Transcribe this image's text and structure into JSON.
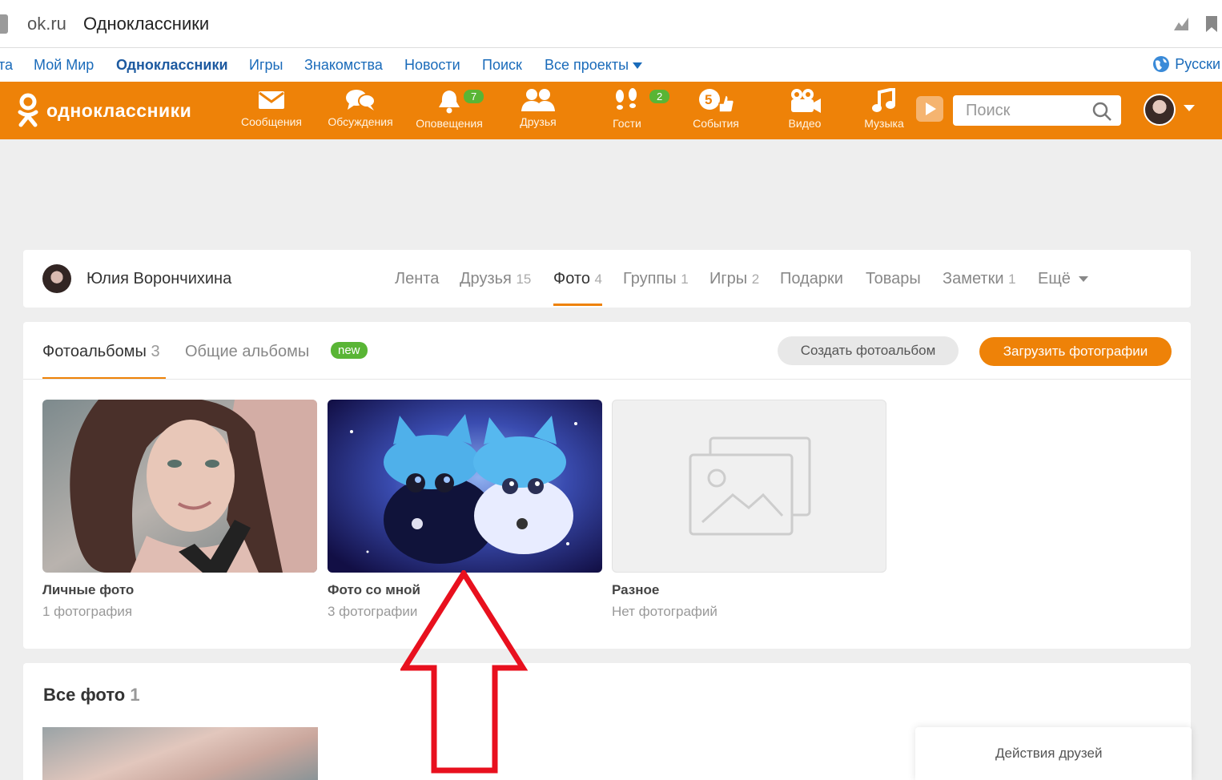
{
  "browser": {
    "domain": "ok.ru",
    "page_title": "Одноклассники"
  },
  "projects": {
    "items": [
      "та",
      "Мой Мир",
      "Одноклассники",
      "Игры",
      "Знакомства",
      "Новости",
      "Поиск",
      "Все проекты"
    ],
    "language": "Русски"
  },
  "header": {
    "logo_text": "одноклассники",
    "nav": [
      {
        "label": "Сообщения",
        "icon": "envelope-icon"
      },
      {
        "label": "Обсуждения",
        "icon": "chat-bubbles-icon"
      },
      {
        "label": "Оповещения",
        "icon": "bell-icon",
        "badge": "7"
      },
      {
        "label": "Друзья",
        "icon": "friends-icon"
      },
      {
        "label": "Гости",
        "icon": "footprints-icon",
        "badge": "2"
      },
      {
        "label": "События",
        "icon": "five-thumbs-up-icon"
      },
      {
        "label": "Видео",
        "icon": "video-camera-icon"
      },
      {
        "label": "Музыка",
        "icon": "music-note-icon"
      }
    ],
    "search_placeholder": "Поиск"
  },
  "profile": {
    "name": "Юлия Ворончихина",
    "tabs": [
      {
        "label": "Лента",
        "count": ""
      },
      {
        "label": "Друзья",
        "count": "15"
      },
      {
        "label": "Фото",
        "count": "4",
        "active": true
      },
      {
        "label": "Группы",
        "count": "1"
      },
      {
        "label": "Игры",
        "count": "2"
      },
      {
        "label": "Подарки",
        "count": ""
      },
      {
        "label": "Товары",
        "count": ""
      },
      {
        "label": "Заметки",
        "count": "1"
      },
      {
        "label": "Ещё",
        "count": ""
      }
    ]
  },
  "albums_section": {
    "tab_albums": "Фотоальбомы",
    "tab_albums_count": "3",
    "tab_shared": "Общие альбомы",
    "new_badge": "new",
    "create_button": "Создать фотоальбом",
    "upload_button": "Загрузить фотографии",
    "albums": [
      {
        "title": "Личные фото",
        "count": "1 фотография"
      },
      {
        "title": "Фото со мной",
        "count": "3 фотографии"
      },
      {
        "title": "Разное",
        "count": "Нет фотографий"
      }
    ]
  },
  "all_photos": {
    "title": "Все фото",
    "count": "1"
  },
  "friends_activity": "Действия друзей",
  "colors": {
    "brand_orange": "#ee8208",
    "badge_green": "#59b535",
    "link_blue": "#1a6bba",
    "annotation_red": "#e8101e"
  }
}
